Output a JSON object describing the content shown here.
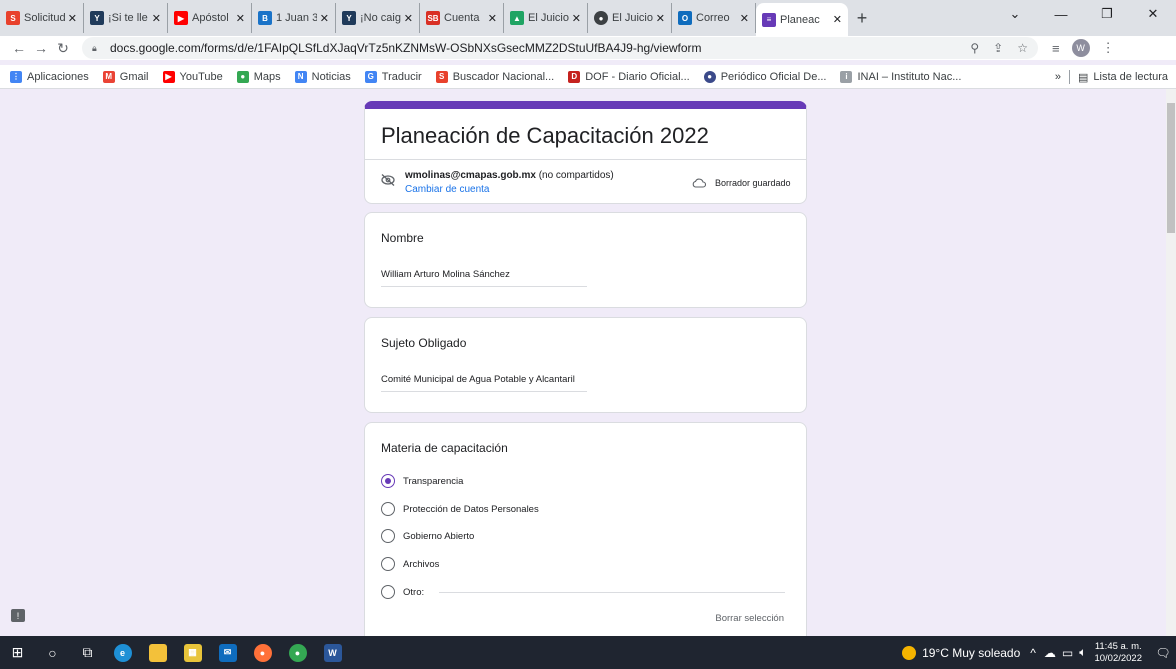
{
  "browser": {
    "tabs": [
      {
        "label": "Solicitud",
        "icon": "pnt-icon",
        "color": "#e8412c"
      },
      {
        "label": "¡Si te lle",
        "icon": "bible-app-icon",
        "color": "#1f3a5a"
      },
      {
        "label": "Apóstol",
        "icon": "youtube-icon",
        "color": "#ff0000"
      },
      {
        "label": "1 Juan 3",
        "icon": "bible-icon",
        "color": "#1a73c8"
      },
      {
        "label": "¡No caig",
        "icon": "bible-app-icon",
        "color": "#1f3a5a"
      },
      {
        "label": "Cuenta",
        "icon": "sb-icon",
        "color": "#d93025"
      },
      {
        "label": "El Juicio",
        "icon": "drive-icon",
        "color": "#1fa463"
      },
      {
        "label": "El Juicio",
        "icon": "globe-icon",
        "color": "#3c4043"
      },
      {
        "label": "Correo",
        "icon": "outlook-icon",
        "color": "#0f6cbd"
      },
      {
        "label": "Planeac",
        "icon": "forms-icon",
        "color": "#673ab7"
      }
    ],
    "url": "docs.google.com/forms/d/e/1FAIpQLSfLdXJaqVrTz5nKZNMsW-OSbNXsGsecMMZ2DStuUfBA4J9-hg/viewform",
    "avatar_initial": "W",
    "bookmarks": [
      {
        "label": "Aplicaciones",
        "icon": "apps-grid-icon",
        "color": "#4285f4"
      },
      {
        "label": "Gmail",
        "icon": "gmail-icon",
        "color": "#ea4335"
      },
      {
        "label": "YouTube",
        "icon": "youtube-icon",
        "color": "#ff0000"
      },
      {
        "label": "Maps",
        "icon": "maps-pin-icon",
        "color": "#34a853"
      },
      {
        "label": "Noticias",
        "icon": "news-icon",
        "color": "#4285f4"
      },
      {
        "label": "Traducir",
        "icon": "translate-icon",
        "color": "#4285f4"
      },
      {
        "label": "Buscador Nacional...",
        "icon": "pnt-icon",
        "color": "#e8412c"
      },
      {
        "label": "DOF - Diario Oficial...",
        "icon": "dof-icon",
        "color": "#c5221f"
      },
      {
        "label": "Periódico Oficial De...",
        "icon": "seal-icon",
        "color": "#3b4a8a"
      },
      {
        "label": "INAI – Instituto Nac...",
        "icon": "inai-icon",
        "color": "#9aa0a6"
      }
    ],
    "bookmarks_more": "»",
    "reading_list": "Lista de lectura"
  },
  "form": {
    "title": "Planeación de Capacitación 2022",
    "account_email": "wmolinas@cmapas.gob.mx",
    "account_note": "(no compartidos)",
    "switch_account": "Cambiar de cuenta",
    "draft_status": "Borrador guardado",
    "accent_color": "#673ab7",
    "questions": [
      {
        "title": "Nombre",
        "answer": "William Arturo Molina Sánchez"
      },
      {
        "title": "Sujeto Obligado",
        "answer": "Comité Municipal de Agua Potable y Alcantaril"
      }
    ],
    "choice_question": {
      "title": "Materia de capacitación",
      "options": [
        {
          "label": "Transparencia",
          "selected": true
        },
        {
          "label": "Protección de Datos Personales",
          "selected": false
        },
        {
          "label": "Gobierno Abierto",
          "selected": false
        },
        {
          "label": "Archivos",
          "selected": false
        },
        {
          "label": "Otro:",
          "selected": false
        }
      ],
      "clear_label": "Borrar selección"
    }
  },
  "taskbar": {
    "weather": "19°C  Muy soleado",
    "time": "11:45 a. m.",
    "date": "10/02/2022"
  }
}
